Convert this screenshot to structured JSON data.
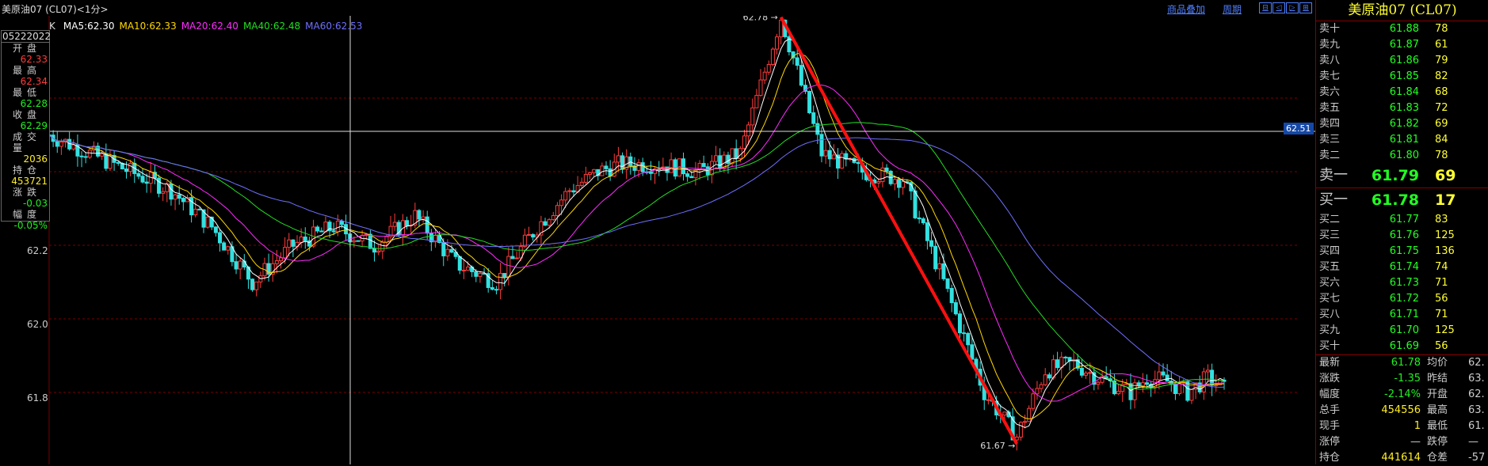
{
  "window": {
    "title": "美原油07 (CL07)<1分>",
    "links": [
      "商品叠加",
      "周期"
    ]
  },
  "ma": {
    "k": "K",
    "items": [
      {
        "label": "MA5:62.30",
        "color": "#ffffff"
      },
      {
        "label": "MA10:62.33",
        "color": "#ffd800"
      },
      {
        "label": "MA20:62.40",
        "color": "#ff2bff"
      },
      {
        "label": "MA40:62.48",
        "color": "#22dd22"
      },
      {
        "label": "MA60:62.53",
        "color": "#6f6fff"
      }
    ]
  },
  "ohlc_box": {
    "date": "05222022",
    "rows": [
      {
        "label": "开盘",
        "value": "62.33",
        "color": "#ff3b3b"
      },
      {
        "label": "最高",
        "value": "62.34",
        "color": "#ff3b3b"
      },
      {
        "label": "最低",
        "value": "62.28",
        "color": "#22ee22"
      },
      {
        "label": "收盘",
        "value": "62.29",
        "color": "#22ee22"
      },
      {
        "label": "成交量",
        "value": "2036",
        "color": "#ffee22"
      },
      {
        "label": "持仓",
        "value": "453721",
        "color": "#ffee22"
      },
      {
        "label": "涨跌",
        "value": "-0.03",
        "color": "#22ee22"
      },
      {
        "label": "幅度",
        "value": "-0.05%",
        "color": "#22ee22"
      }
    ]
  },
  "axis": {
    "y_labels": [
      {
        "label": "62.2",
        "value": 62.2
      },
      {
        "label": "62.0",
        "value": 62.0
      },
      {
        "label": "61.8",
        "value": 61.8
      }
    ],
    "crosshair_price": "62.51"
  },
  "annotations": {
    "high": "62.78",
    "low": "61.67"
  },
  "orderbook": {
    "title": "美原油07 (CL07)",
    "asks": [
      {
        "name": "卖十",
        "price": "61.88",
        "qty": "78"
      },
      {
        "name": "卖九",
        "price": "61.87",
        "qty": "61"
      },
      {
        "name": "卖八",
        "price": "61.86",
        "qty": "79"
      },
      {
        "name": "卖七",
        "price": "61.85",
        "qty": "82"
      },
      {
        "name": "卖六",
        "price": "61.84",
        "qty": "68"
      },
      {
        "name": "卖五",
        "price": "61.83",
        "qty": "72"
      },
      {
        "name": "卖四",
        "price": "61.82",
        "qty": "69"
      },
      {
        "name": "卖三",
        "price": "61.81",
        "qty": "84"
      },
      {
        "name": "卖二",
        "price": "61.80",
        "qty": "78"
      },
      {
        "name": "卖一",
        "price": "61.79",
        "qty": "69"
      }
    ],
    "bids": [
      {
        "name": "买一",
        "price": "61.78",
        "qty": "17"
      },
      {
        "name": "买二",
        "price": "61.77",
        "qty": "83"
      },
      {
        "name": "买三",
        "price": "61.76",
        "qty": "125"
      },
      {
        "name": "买四",
        "price": "61.75",
        "qty": "136"
      },
      {
        "name": "买五",
        "price": "61.74",
        "qty": "74"
      },
      {
        "name": "买六",
        "price": "61.73",
        "qty": "71"
      },
      {
        "name": "买七",
        "price": "61.72",
        "qty": "56"
      },
      {
        "name": "买八",
        "price": "61.71",
        "qty": "71"
      },
      {
        "name": "买九",
        "price": "61.70",
        "qty": "125"
      },
      {
        "name": "买十",
        "price": "61.69",
        "qty": "56"
      }
    ]
  },
  "stats": [
    {
      "a": "最新",
      "b": "61.78",
      "bcolor": "#22ee22",
      "c": "均价",
      "d": "62."
    },
    {
      "a": "涨跌",
      "b": "-1.35",
      "bcolor": "#22ee22",
      "c": "昨结",
      "d": "63."
    },
    {
      "a": "幅度",
      "b": "-2.14%",
      "bcolor": "#22ee22",
      "c": "开盘",
      "d": "62."
    },
    {
      "a": "总手",
      "b": "454556",
      "bcolor": "#ffee22",
      "c": "最高",
      "d": "63."
    },
    {
      "a": "现手",
      "b": "1",
      "bcolor": "#ffee22",
      "c": "最低",
      "d": "61."
    },
    {
      "a": "涨停",
      "b": "—",
      "bcolor": "#cccccc",
      "c": "跌停",
      "d": "—"
    },
    {
      "a": "持仓",
      "b": "441614",
      "bcolor": "#ffee22",
      "c": "仓差",
      "d": "-57"
    }
  ],
  "chart_data": {
    "type": "candlestick",
    "y_range": [
      61.6,
      62.9
    ],
    "keypoints_x": [
      0,
      10,
      20,
      30,
      40,
      50,
      60,
      70,
      80,
      90,
      100,
      110,
      120,
      128,
      135,
      140,
      150,
      160,
      170,
      180,
      190,
      200,
      210,
      220,
      230,
      238,
      245,
      252,
      258,
      262,
      266,
      270,
      275,
      280,
      285,
      290
    ],
    "keypoints_y": [
      62.5,
      62.45,
      62.4,
      62.35,
      62.25,
      62.1,
      62.2,
      62.25,
      62.2,
      62.28,
      62.15,
      62.1,
      62.25,
      62.35,
      62.4,
      62.42,
      62.42,
      62.4,
      62.45,
      62.82,
      62.45,
      62.4,
      62.38,
      62.1,
      61.8,
      61.68,
      61.86,
      61.88,
      61.84,
      61.82,
      61.8,
      61.84,
      61.83,
      61.8,
      61.84,
      61.8
    ],
    "bar_count": 290
  }
}
